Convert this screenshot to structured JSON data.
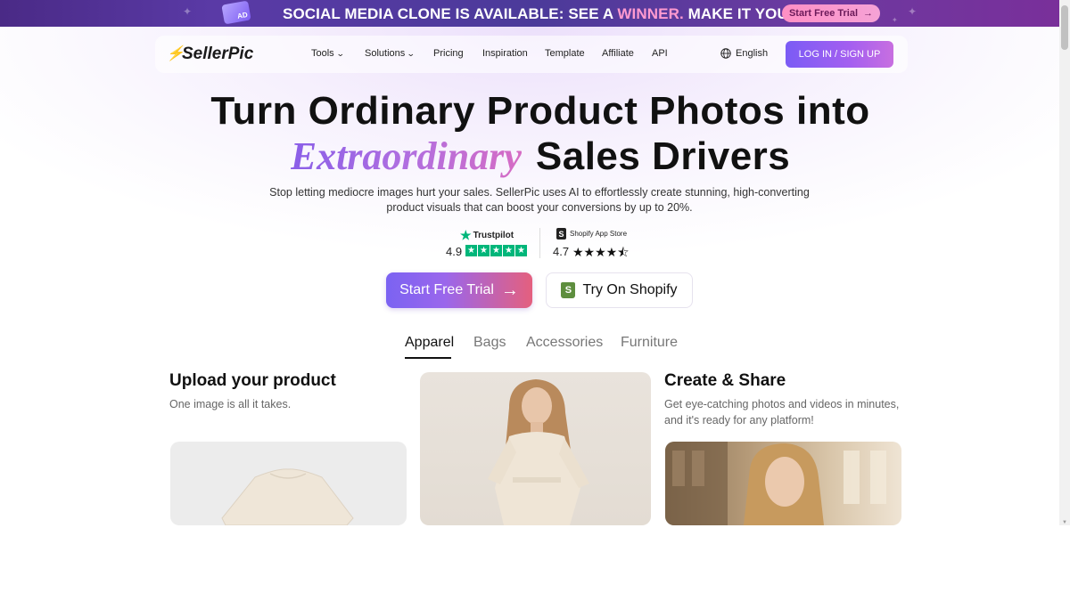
{
  "promo": {
    "badge": "AD",
    "text_1": "SOCIAL MEDIA CLONE",
    "text_2": " IS AVAILABLE: SEE A ",
    "text_3": "WINNER.",
    "text_4": " MAKE IT YOURS.",
    "button_label": "Start Free Trial",
    "button_arrow": "→"
  },
  "nav": {
    "logo_text": "SellerPic",
    "items": [
      {
        "label": "Tools",
        "has_dropdown": true
      },
      {
        "label": "Solutions",
        "has_dropdown": true
      },
      {
        "label": "Pricing",
        "has_dropdown": false
      },
      {
        "label": "Inspiration",
        "has_dropdown": false
      },
      {
        "label": "Template",
        "has_dropdown": false
      },
      {
        "label": "Affiliate",
        "has_dropdown": false
      },
      {
        "label": "API",
        "has_dropdown": false
      }
    ],
    "chevron": "⌄",
    "language": "English",
    "login_label": "LOG IN / SIGN UP"
  },
  "hero": {
    "headline_line1": "Turn Ordinary Product Photos into",
    "headline_fancy": "Extraordinary",
    "headline_line2_rest": "Sales Drivers",
    "subtitle": "Stop letting mediocre images hurt your sales. SellerPic uses AI to effortlessly create stunning, high-converting product visuals that can boost your conversions by up to 20%."
  },
  "ratings": {
    "trustpilot": {
      "brand": "Trustpilot",
      "score": "4.9",
      "stars": 5
    },
    "shopify": {
      "brand": "Shopify App Store",
      "score": "4.7",
      "stars_display": "★★★★⯪"
    }
  },
  "cta": {
    "primary_label": "Start Free Trial",
    "primary_arrow": "→",
    "secondary_label": "Try On Shopify",
    "secondary_icon": "S"
  },
  "tabs": {
    "items": [
      "Apparel",
      "Bags",
      "Accessories",
      "Furniture"
    ],
    "active": "Apparel"
  },
  "columns": {
    "upload": {
      "title": "Upload your product",
      "desc": "One image is all it takes."
    },
    "share": {
      "title": "Create & Share",
      "desc": "Get eye-catching photos and videos in minutes, and it's ready for any platform!"
    }
  },
  "colors": {
    "accent_purple": "#7b5cf5",
    "trustpilot_green": "#00b67a",
    "shopify_green": "#5e8e3e",
    "promo_pink": "#ff9ad0"
  }
}
